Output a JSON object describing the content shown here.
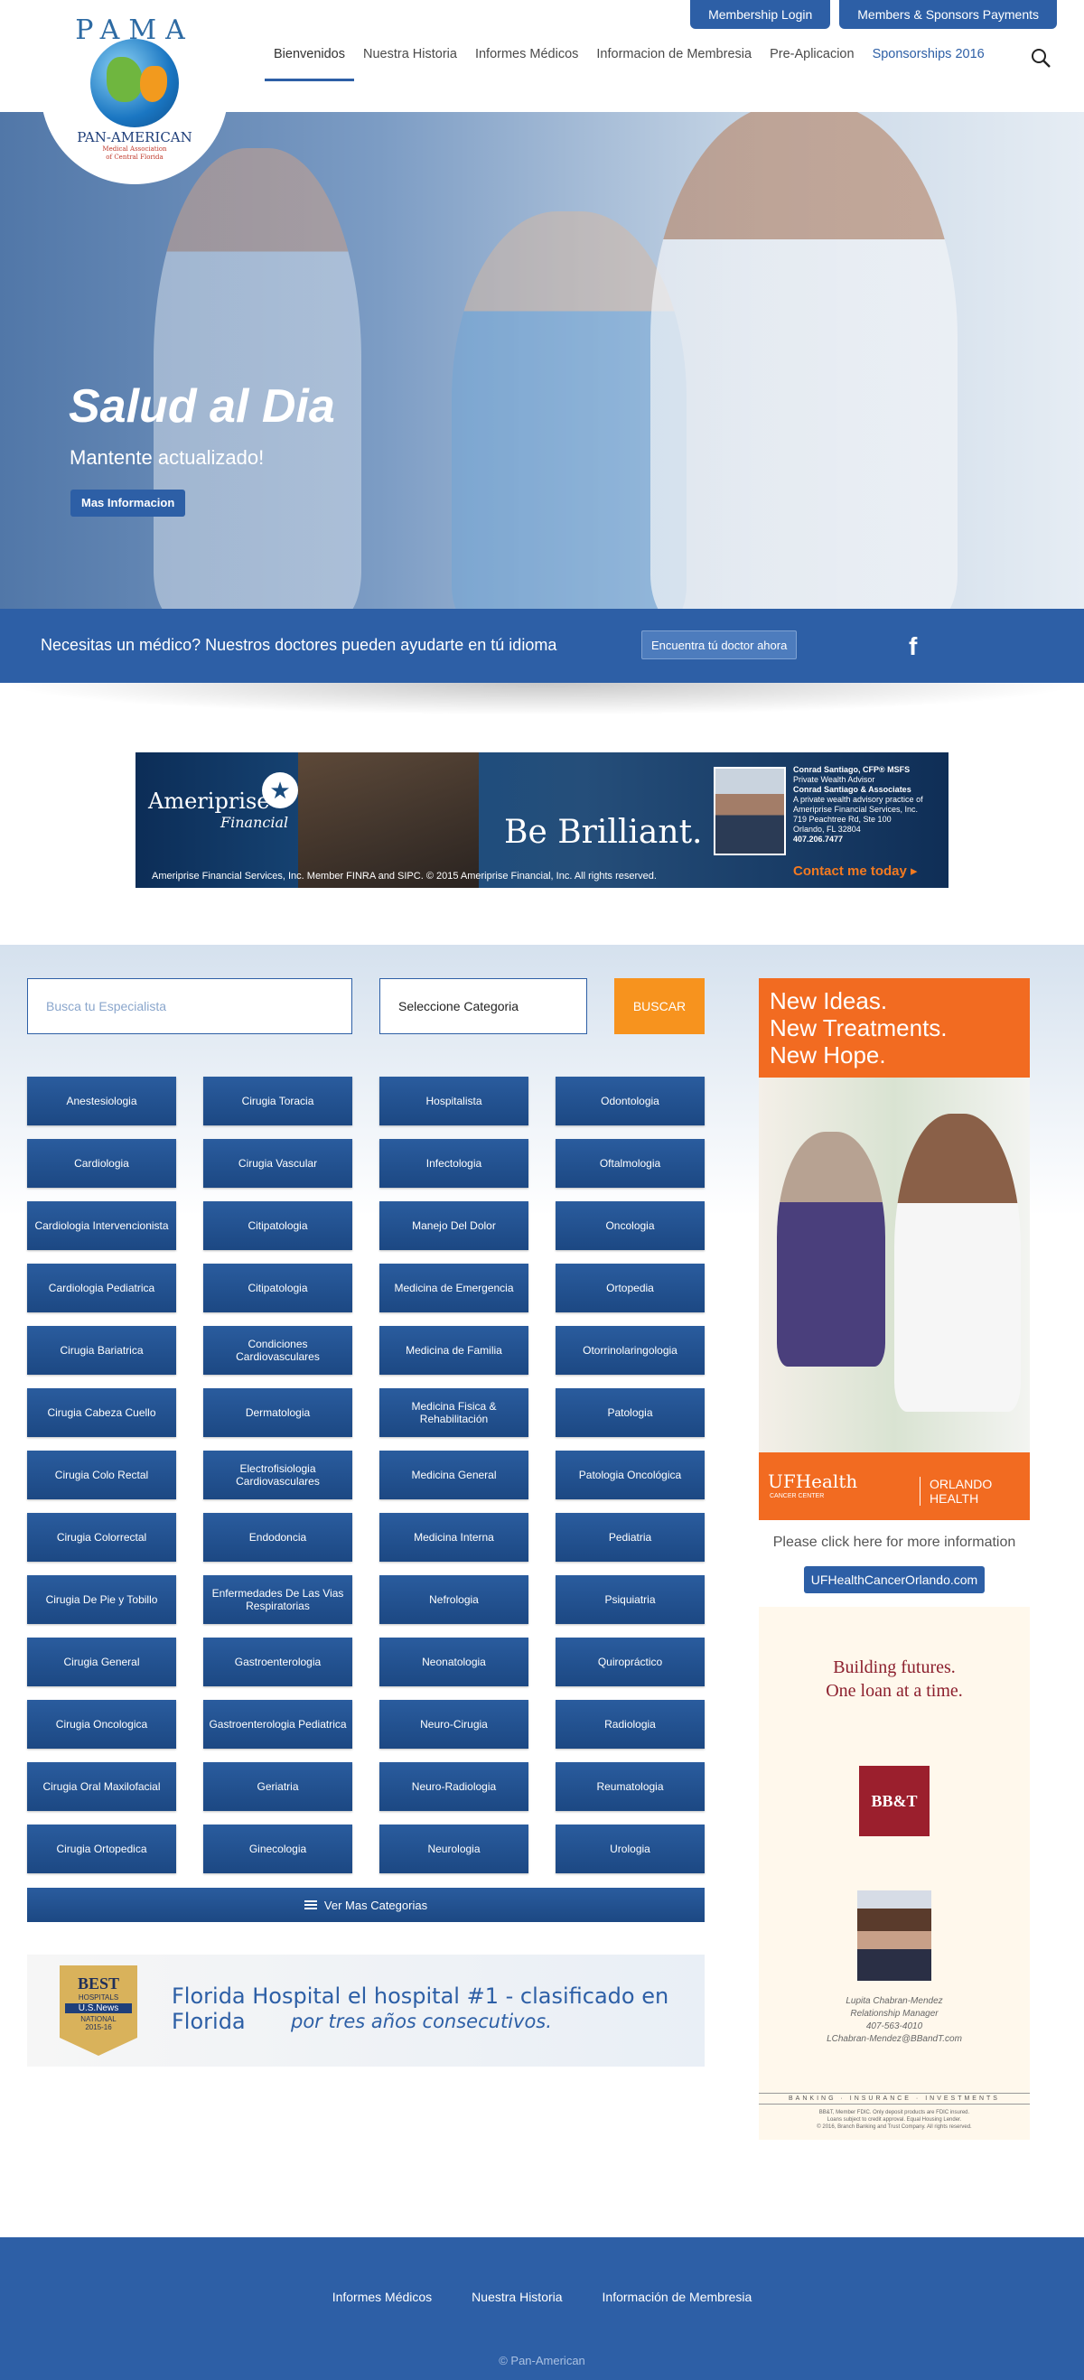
{
  "header": {
    "top_buttons": [
      "Membership Login",
      "Members & Sponsors Payments"
    ],
    "nav": [
      "Bienvenidos",
      "Nuestra Historia",
      "Informes Médicos",
      "Informacion de Membresia",
      "Pre-Aplicacion",
      "Sponsorships 2016"
    ],
    "logo": {
      "acronym": "PAMA",
      "name": "PAN-AMERICAN",
      "subtitle_line1": "Medical Association",
      "subtitle_line2": "of Central Florida"
    }
  },
  "hero": {
    "title": "Salud al Dia",
    "subtitle": "Mantente actualizado!",
    "button": "Mas Informacion"
  },
  "doctor_bar": {
    "text": "Necesitas un médico? Nuestros doctores pueden ayudarte en tú idioma",
    "button": "Encuentra tú doctor ahora",
    "social": "f"
  },
  "ameriprise_ad": {
    "brand": "Ameriprise",
    "brand_sub": "Financial",
    "tagline": "Be Brilliant.",
    "advisor_name": "Conrad Santiago, CFP® MSFS",
    "advisor_title": "Private Wealth Advisor",
    "firm": "Conrad Santiago & Associates",
    "firm_desc": "A private wealth advisory practice of Ameriprise Financial Services, Inc.",
    "address1": "719 Peachtree Rd, Ste 100",
    "address2": "Orlando, FL 32804",
    "phone": "407.206.7477",
    "cta": "Contact me today ▸",
    "footer": "Ameriprise Financial Services, Inc. Member FINRA and SIPC. © 2015 Ameriprise Financial, Inc. All rights reserved."
  },
  "search": {
    "placeholder": "Busca tu Especialista",
    "category": "Seleccione Categoria",
    "button": "BUSCAR"
  },
  "specialties": [
    "Anestesiologia",
    "Cirugia Toracia",
    "Hospitalista",
    "Odontologia",
    "Cardiologia",
    "Cirugia Vascular",
    "Infectologia",
    "Oftalmologia",
    "Cardiologia Intervencionista",
    "Citipatologia",
    "Manejo Del Dolor",
    "Oncologia",
    "Cardiologia Pediatrica",
    "Citipatologia",
    "Medicina de Emergencia",
    "Ortopedia",
    "Cirugia Bariatrica",
    "Condiciones Cardiovasculares",
    "Medicina de Familia",
    "Otorrinolaringologia",
    "Cirugia Cabeza Cuello",
    "Dermatologia",
    "Medicina Fisica & Rehabilitación",
    "Patologia",
    "Cirugia Colo Rectal",
    "Electrofisiologia Cardiovasculares",
    "Medicina General",
    "Patologia Oncológica",
    "Cirugia Colorrectal",
    "Endodoncia",
    "Medicina Interna",
    "Pediatria",
    "Cirugia De Pie y Tobillo",
    "Enfermedades De Las Vias Respiratorias",
    "Nefrologia",
    "Psiquiatria",
    "Cirugia General",
    "Gastroenterologia",
    "Neonatologia",
    "Quiropráctico",
    "Cirugia Oncologica",
    "Gastroenterologia Pediatrica",
    "Neuro-Cirugia",
    "Radiologia",
    "Cirugia Oral Maxilofacial",
    "Geriatria",
    "Neuro-Radiologia",
    "Reumatologia",
    "Cirugia Ortopedica",
    "Ginecologia",
    "Neurologia",
    "Urologia"
  ],
  "more_categories": "Ver Mas Categorias",
  "florida_hospital": {
    "badge_best": "BEST",
    "badge_hospitals": "HOSPITALS",
    "badge_brand": "U.S.News",
    "badge_national": "NATIONAL",
    "badge_years": "2015-16",
    "line1": "Florida Hospital el hospital #1 - clasificado en Florida",
    "line2": "por tres años consecutivos."
  },
  "uf_ad": {
    "headline": [
      "New Ideas.",
      "New Treatments.",
      "New Hope."
    ],
    "logo1": "UFHealth",
    "logo1_sub": "CANCER CENTER",
    "logo2": "ORLANDO HEALTH",
    "caption": "Please click here for more information",
    "link": "UFHealthCancerOrlando.com"
  },
  "bbt_ad": {
    "headline1": "Building futures.",
    "headline2": "One loan at a time.",
    "logo": "BB&T",
    "contact_name": "Lupita Chabran-Mendez",
    "contact_title": "Relationship Manager",
    "contact_phone": "407-563-4010",
    "contact_email": "LChabran-Mendez@BBandT.com",
    "tagline": "BANKING · INSURANCE · INVESTMENTS",
    "fine1": "BB&T, Member FDIC. Only deposit products are FDIC insured.",
    "fine2": "Loans subject to credit approval. Equal Housing Lender.",
    "fine3": "© 2016, Branch Banking and Trust Company. All rights reserved."
  },
  "footer": {
    "links": [
      "Informes Médicos",
      "Nuestra Historia",
      "Información de Membresia"
    ],
    "copyright": "© Pan-American"
  }
}
